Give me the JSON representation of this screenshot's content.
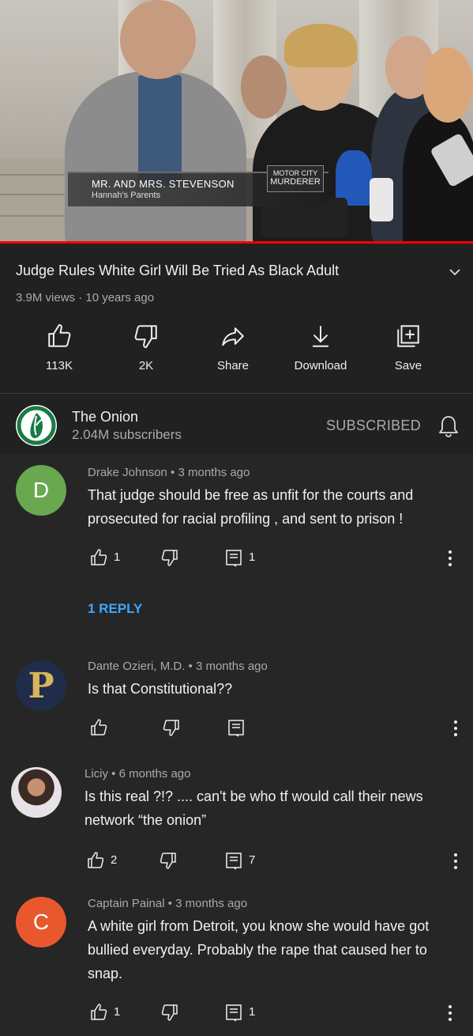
{
  "video": {
    "lower_third_name": "MR. AND MRS. STEVENSON",
    "lower_third_sub": "Hannah's Parents",
    "badge_line1": "MOTOR CITY",
    "badge_line2": "MURDERER",
    "progress": 1.0,
    "accent": "#ff0000"
  },
  "title": "Judge Rules White Girl Will Be Tried As Black Adult",
  "meta": "3.9M views · 10 years ago",
  "actions": [
    {
      "label": "113K",
      "icon": "thumbs-up-icon"
    },
    {
      "label": "2K",
      "icon": "thumbs-down-icon"
    },
    {
      "label": "Share",
      "icon": "share-icon"
    },
    {
      "label": "Download",
      "icon": "download-icon"
    },
    {
      "label": "Save",
      "icon": "save-icon"
    }
  ],
  "channel": {
    "name": "The Onion",
    "subscribers": "2.04M subscribers",
    "subscribe_state": "SUBSCRIBED"
  },
  "comments": [
    {
      "author_line": "Drake Johnson • 3 months ago",
      "avatar_letter": "D",
      "avatar_color": "#6aa84f",
      "text": "That judge should be free as unfit for the courts and prosecuted for racial profiling , and sent to prison  !",
      "likes": "1",
      "replies": "1",
      "reply_link": "1 REPLY"
    },
    {
      "author_line": "Dante Ozieri, M.D. • 3 months ago",
      "avatar_letter": "P",
      "text": "Is  that Constitutional??",
      "likes": "",
      "replies": ""
    },
    {
      "author_line": "Liciy • 6 months ago",
      "text": "Is this real ?!? .... can't be who tf would call their news network “the onion”",
      "likes": "2",
      "replies": "7"
    },
    {
      "author_line": "Captain Painal • 3 months ago",
      "avatar_letter": "C",
      "avatar_color": "#e8582c",
      "text": "A white girl from Detroit,  you know she would have got bullied everyday. Probably the rape that caused her to snap.",
      "likes": "1",
      "replies": "1"
    }
  ]
}
